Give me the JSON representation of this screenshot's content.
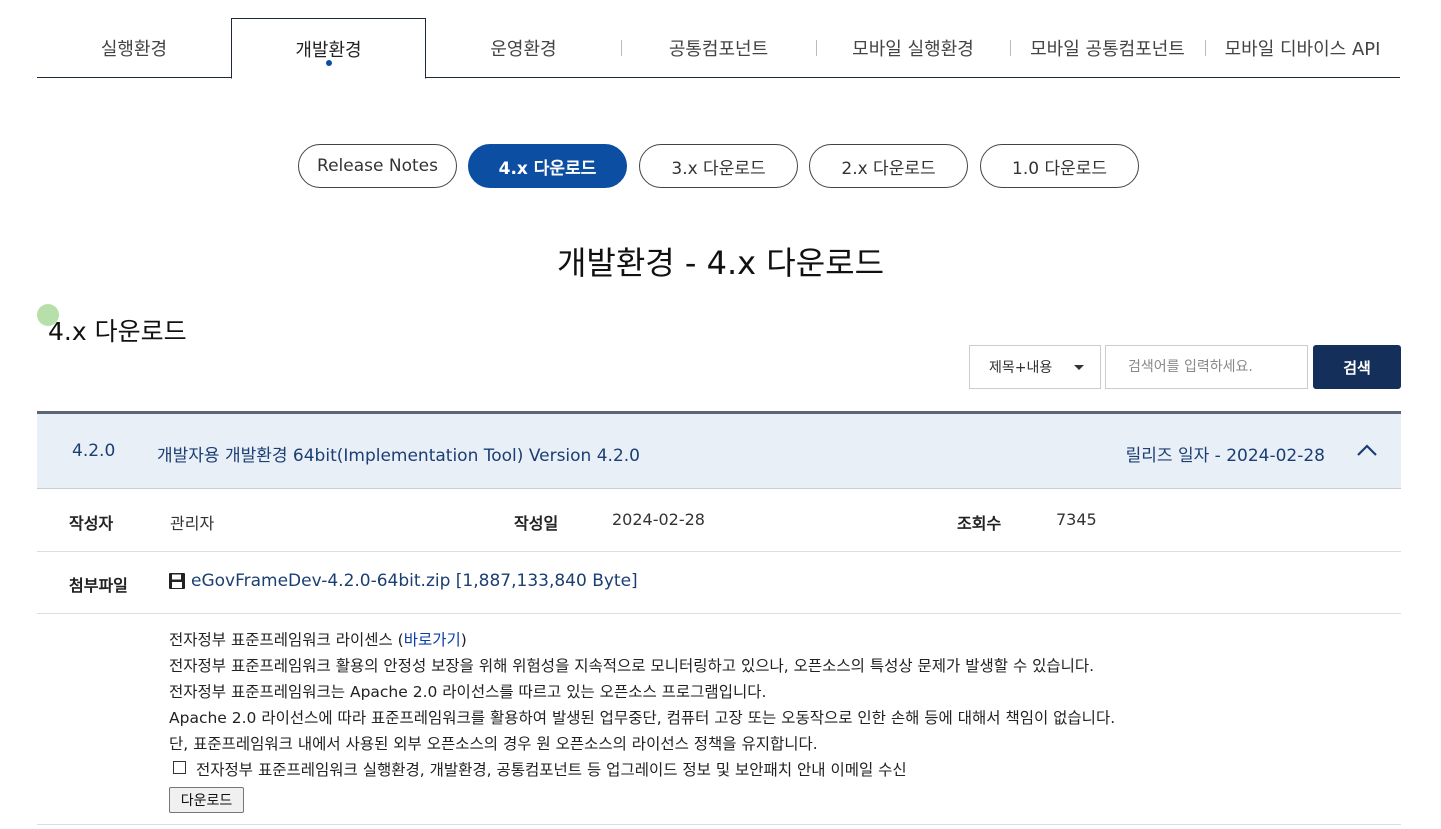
{
  "top_tabs": [
    {
      "label": "실행환경",
      "active": false
    },
    {
      "label": "개발환경",
      "active": true
    },
    {
      "label": "운영환경",
      "active": false
    },
    {
      "label": "공통컴포넌트",
      "active": false
    },
    {
      "label": "모바일 실행환경",
      "active": false
    },
    {
      "label": "모바일 공통컴포넌트",
      "active": false
    },
    {
      "label": "모바일 디바이스 API",
      "active": false
    }
  ],
  "pills": [
    {
      "label": "Release Notes",
      "active": false
    },
    {
      "label": "4.x 다운로드",
      "active": true
    },
    {
      "label": "3.x 다운로드",
      "active": false
    },
    {
      "label": "2.x 다운로드",
      "active": false
    },
    {
      "label": "1.0 다운로드",
      "active": false
    }
  ],
  "page_title": "개발환경 - 4.x 다운로드",
  "section_title": "4.x 다운로드",
  "search": {
    "select_value": "제목+내용",
    "placeholder": "검색어를 입력하세요.",
    "button_label": "검색"
  },
  "item": {
    "version": "4.2.0",
    "name": "개발자용 개발환경 64bit(Implementation Tool) Version 4.2.0",
    "release_date": "릴리즈 일자 - 2024-02-28",
    "author_label": "작성자",
    "author": "관리자",
    "date_label": "작성일",
    "date": "2024-02-28",
    "views_label": "조회수",
    "views": "7345",
    "attach_label": "첨부파일",
    "attach_file": "eGovFrameDev-4.2.0-64bit.zip [1,887,133,840 Byte]",
    "license_prefix": "전자정부 표준프레임워크 라이센스 (",
    "license_link": "바로가기",
    "license_suffix": ")",
    "body_lines": [
      "전자정부 표준프레임워크 활용의 안정성 보장을 위해 위험성을 지속적으로 모니터링하고 있으나, 오픈소스의 특성상 문제가 발생할 수 있습니다.",
      "전자정부 표준프레임워크는 Apache 2.0 라이선스를 따르고 있는 오픈소스 프로그램입니다.",
      "Apache 2.0 라이선스에 따라 표준프레임워크를 활용하여 발생된 업무중단, 컴퓨터 고장 또는 오동작으로 인한 손해 등에 대해서 책임이 없습니다.",
      "단, 표준프레임워크 내에서 사용된 외부 오픈소스의 경우 원 오픈소스의 라이선스 정책을 유지합니다."
    ],
    "email_consent": "전자정부 표준프레임워크 실행환경, 개발환경, 공통컴포넌트 등 업그레이드 정보 및 보안패치 안내 이메일 수신",
    "download_button": "다운로드"
  }
}
